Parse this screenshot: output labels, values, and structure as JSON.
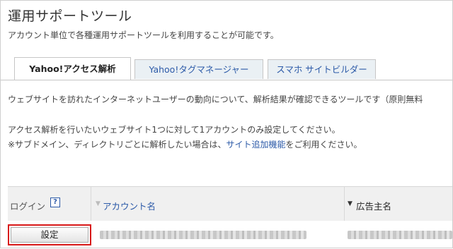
{
  "page": {
    "title": "運用サポートツール",
    "subtitle": "アカウント単位で各種運用サポートツールを利用することが可能です。"
  },
  "tabs": [
    {
      "label": "Yahoo!アクセス解析",
      "active": true
    },
    {
      "label": "Yahoo!タグマネージャー",
      "active": false
    },
    {
      "label": "スマホ サイトビルダー",
      "active": false
    }
  ],
  "content": {
    "description": "ウェブサイトを訪れたインターネットユーザーの動向について、解析結果が確認できるツールです（原則無料",
    "note1": "アクセス解析を行いたいウェブサイト1つに対して1アカウントのみ設定してください。",
    "note2_prefix": "※サブドメイン、ディレクトリごとに解析したい場合は、",
    "note2_link": "サイト追加機能",
    "note2_suffix": "をご利用ください。"
  },
  "table": {
    "headers": {
      "login": "ログイン",
      "help_icon_text": "?",
      "account_sort_icon": "▼",
      "account_name": "アカウント名",
      "advertiser_sort_icon": "▼",
      "advertiser_name": "広告主名"
    },
    "row": {
      "button_label": "設定"
    }
  },
  "icons": {
    "help": "help-icon",
    "sort_account": "sort-icon",
    "sort_advertiser": "sort-icon"
  },
  "colors": {
    "link": "#2c5aa8",
    "highlight_border": "#d81818",
    "tab_inactive_bg": "#eaf0f4",
    "header_bg": "#f0f0f0"
  }
}
